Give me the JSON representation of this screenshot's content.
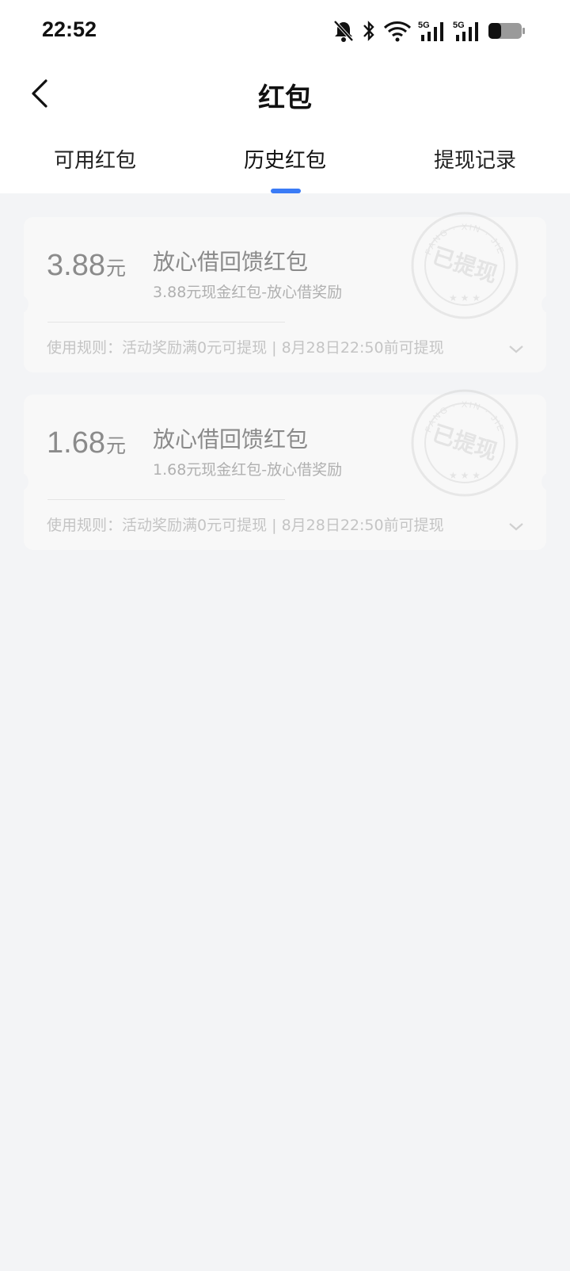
{
  "status_bar": {
    "time": "22:52",
    "battery": "34",
    "icons": [
      "mute-icon",
      "bluetooth-icon",
      "wifi-icon",
      "signal-5g-icon",
      "signal-5g-icon",
      "battery-icon"
    ]
  },
  "header": {
    "title": "红包",
    "back_icon": "chevron-left-icon"
  },
  "tabs": [
    {
      "label": "可用红包",
      "active": false
    },
    {
      "label": "历史红包",
      "active": true
    },
    {
      "label": "提现记录",
      "active": false
    }
  ],
  "accent_color": "#3a7bf6",
  "cards": [
    {
      "amount": "3.88",
      "unit": "元",
      "title": "放心借回馈红包",
      "subtitle": "3.88元现金红包-放心借奖励",
      "rule": "使用规则：活动奖励满0元可提现 | 8月28日22:50前可提现",
      "stamp_text": "已提现",
      "stamp_ring": "FANG · XIN · JIE"
    },
    {
      "amount": "1.68",
      "unit": "元",
      "title": "放心借回馈红包",
      "subtitle": "1.68元现金红包-放心借奖励",
      "rule": "使用规则：活动奖励满0元可提现 | 8月28日22:50前可提现",
      "stamp_text": "已提现",
      "stamp_ring": "FANG · XIN · JIE"
    }
  ]
}
